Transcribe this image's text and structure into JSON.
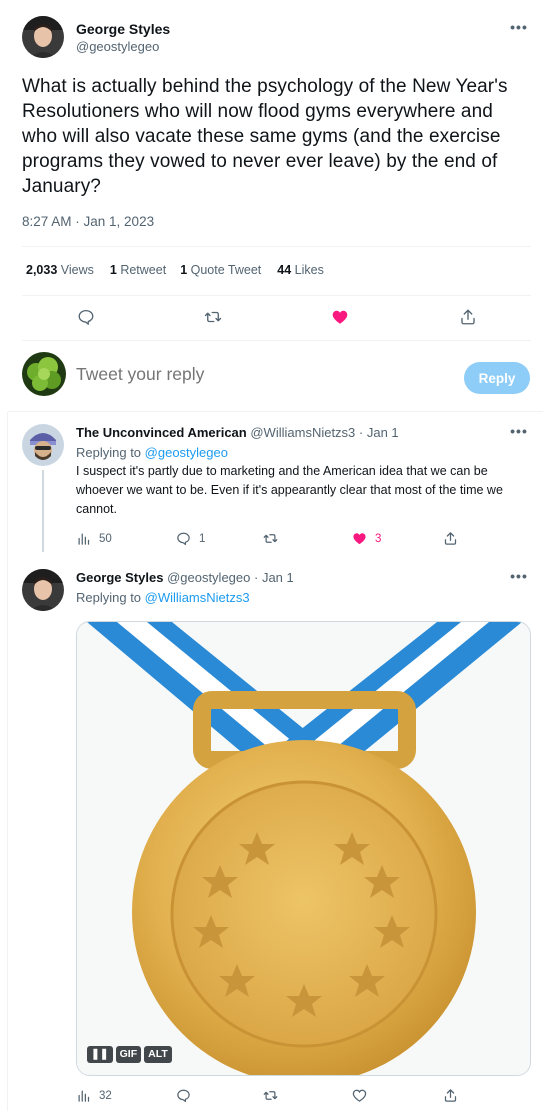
{
  "main_tweet": {
    "author_name": "George Styles",
    "author_handle": "@geostylegeo",
    "text": "What is actually behind the psychology of the New Year's Resolutioners who will now flood gyms everywhere and who will also vacate these same gyms (and the exercise programs they vowed to never ever leave) by the end of January?",
    "timestamp": "8:27 AM · Jan 1, 2023",
    "stats": {
      "views_count": "2,033",
      "views_label": "Views",
      "retweets_count": "1",
      "retweets_label": "Retweet",
      "quotes_count": "1",
      "quotes_label": "Quote Tweet",
      "likes_count": "44",
      "likes_label": "Likes"
    },
    "icons": [
      "reply-icon",
      "retweet-icon",
      "heart-filled-icon",
      "share-icon"
    ],
    "more_label": "•••"
  },
  "composer": {
    "placeholder": "Tweet your reply",
    "button_label": "Reply"
  },
  "replies": [
    {
      "author_name": "The Unconvinced American",
      "author_handle": "@WilliamsNietzs3",
      "date": "· Jan 1",
      "replying_prefix": "Replying to",
      "replying_to": "@geostylegeo",
      "text": "I suspect it's partly due to marketing and the American idea that we can be whoever we want to be. Even if it's appearantly clear that most of the time we cannot.",
      "views": "50",
      "replies": "1",
      "retweets": "",
      "likes": "3",
      "more_label": "•••"
    },
    {
      "author_name": "George Styles",
      "author_handle": "@geostylegeo",
      "date": "· Jan 1",
      "replying_prefix": "Replying to",
      "replying_to": "@WilliamsNietzs3",
      "media": {
        "type": "GIF",
        "pause_label": "❚❚",
        "gif_label": "GIF",
        "alt_label": "ALT",
        "depicts": "gold medal with blue and white ribbon"
      },
      "views": "32",
      "more_label": "•••"
    }
  ],
  "colors": {
    "accent": "#1d9bf0",
    "like": "#f91880",
    "muted": "#536471",
    "reply_button_disabled": "#8ecdf8"
  }
}
